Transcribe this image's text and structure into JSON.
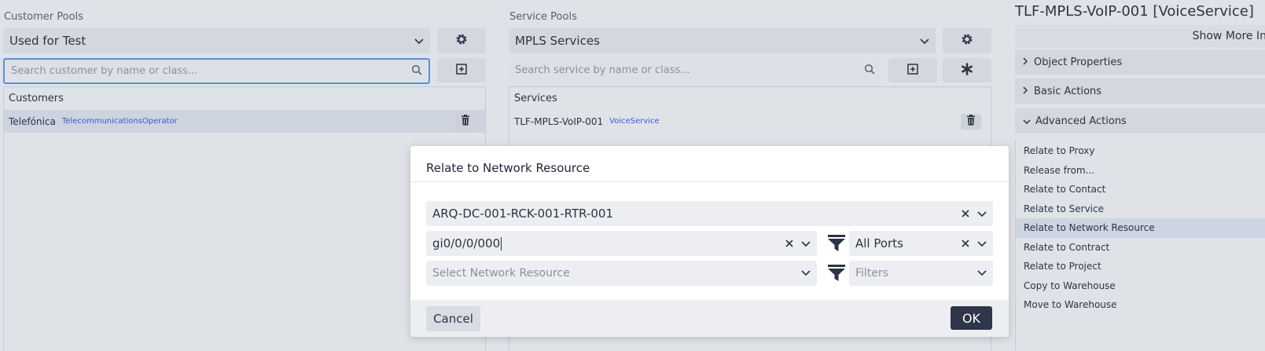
{
  "customer_pools": {
    "label": "Customer Pools",
    "selected": "Used for Test",
    "search_placeholder": "Search customer by name or class...",
    "list_header": "Customers",
    "items": [
      {
        "name": "Telefónica",
        "class": "TelecommunicationsOperator"
      }
    ]
  },
  "service_pools": {
    "label": "Service Pools",
    "selected": "MPLS Services",
    "search_placeholder": "Search service by name or class...",
    "list_header": "Services",
    "items": [
      {
        "name": "TLF-MPLS-VoIP-001",
        "class": "VoiceService"
      }
    ]
  },
  "right_panel": {
    "title": "TLF-MPLS-VoIP-001 [VoiceService]",
    "show_more": "Show More In",
    "sections": [
      {
        "label": "Object Properties",
        "expanded": false
      },
      {
        "label": "Basic Actions",
        "expanded": false
      },
      {
        "label": "Advanced Actions",
        "expanded": true
      }
    ],
    "actions": [
      "Relate to Proxy",
      "Release from...",
      "Relate to Contact",
      "Relate to Service",
      "Relate to Network Resource",
      "Relate to Contract",
      "Relate to Project",
      "Copy to Warehouse",
      "Move to Warehouse"
    ],
    "selected_action": "Relate to Network Resource"
  },
  "modal": {
    "title": "Relate to Network Resource",
    "device": "ARQ-DC-001-RCK-001-RTR-001",
    "port": "gi0/0/0/000",
    "port_filter": "All Ports",
    "resource_placeholder": "Select Network Resource",
    "filters_placeholder": "Filters",
    "cancel_label": "Cancel",
    "ok_label": "OK"
  },
  "colors": {
    "accent": "#5c8fd6",
    "primary_button": "#2f3649",
    "class_link": "#3a5ad0"
  }
}
